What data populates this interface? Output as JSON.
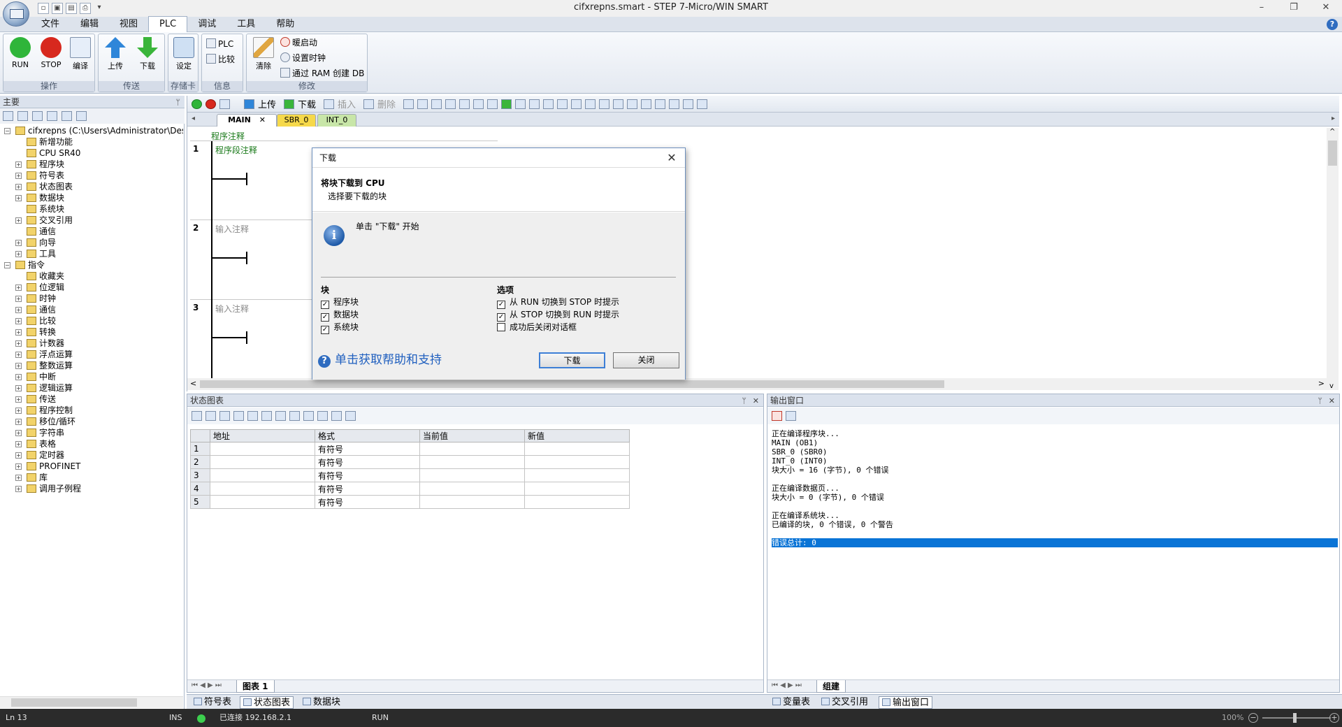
{
  "window": {
    "title": "cifxrepns.smart - STEP 7-Micro/WIN SMART",
    "quick_access": [
      "▫",
      "▣",
      "▤",
      "⎙",
      "▾"
    ],
    "controls": {
      "minimize": "–",
      "restore": "❐",
      "close": "✕"
    }
  },
  "menu": {
    "items": [
      "文件",
      "编辑",
      "视图",
      "PLC",
      "调试",
      "工具",
      "帮助"
    ],
    "active": "PLC",
    "help_icon": "?"
  },
  "ribbon": {
    "groups": [
      {
        "label": "操作",
        "buttons": [
          "RUN",
          "STOP",
          "编译"
        ]
      },
      {
        "label": "传送",
        "buttons": [
          "上传",
          "下载"
        ]
      },
      {
        "label": "存储卡",
        "buttons": [
          "设定"
        ]
      },
      {
        "label": "信息",
        "buttons": [
          "PLC",
          "比较"
        ]
      },
      {
        "label": "修改",
        "buttons": [
          "清除",
          "暖启动",
          "设置时钟",
          "通过 RAM 创建 DB"
        ]
      }
    ],
    "colors": {
      "run": "#2fb53a",
      "stop": "#d7281e",
      "upload": "#2f86d9",
      "download": "#3ab53a"
    }
  },
  "left_panel": {
    "title": "主要",
    "pin": "ᛘ",
    "tree": [
      {
        "label": "cifxrepns (C:\\Users\\Administrator\\Desktop\\hor",
        "level": 0,
        "exp": "−"
      },
      {
        "label": "新增功能",
        "level": 1,
        "exp": ""
      },
      {
        "label": "CPU SR40",
        "level": 1,
        "exp": ""
      },
      {
        "label": "程序块",
        "level": 1,
        "exp": "+"
      },
      {
        "label": "符号表",
        "level": 1,
        "exp": "+"
      },
      {
        "label": "状态图表",
        "level": 1,
        "exp": "+"
      },
      {
        "label": "数据块",
        "level": 1,
        "exp": "+"
      },
      {
        "label": "系统块",
        "level": 1,
        "exp": ""
      },
      {
        "label": "交叉引用",
        "level": 1,
        "exp": "+"
      },
      {
        "label": "通信",
        "level": 1,
        "exp": ""
      },
      {
        "label": "向导",
        "level": 1,
        "exp": "+"
      },
      {
        "label": "工具",
        "level": 1,
        "exp": "+"
      },
      {
        "label": "指令",
        "level": 0,
        "exp": "−"
      },
      {
        "label": "收藏夹",
        "level": 1,
        "exp": ""
      },
      {
        "label": "位逻辑",
        "level": 1,
        "exp": "+"
      },
      {
        "label": "时钟",
        "level": 1,
        "exp": "+"
      },
      {
        "label": "通信",
        "level": 1,
        "exp": "+"
      },
      {
        "label": "比较",
        "level": 1,
        "exp": "+"
      },
      {
        "label": "转换",
        "level": 1,
        "exp": "+"
      },
      {
        "label": "计数器",
        "level": 1,
        "exp": "+"
      },
      {
        "label": "浮点运算",
        "level": 1,
        "exp": "+"
      },
      {
        "label": "整数运算",
        "level": 1,
        "exp": "+"
      },
      {
        "label": "中断",
        "level": 1,
        "exp": "+"
      },
      {
        "label": "逻辑运算",
        "level": 1,
        "exp": "+"
      },
      {
        "label": "传送",
        "level": 1,
        "exp": "+"
      },
      {
        "label": "程序控制",
        "level": 1,
        "exp": "+"
      },
      {
        "label": "移位/循环",
        "level": 1,
        "exp": "+"
      },
      {
        "label": "字符串",
        "level": 1,
        "exp": "+"
      },
      {
        "label": "表格",
        "level": 1,
        "exp": "+"
      },
      {
        "label": "定时器",
        "level": 1,
        "exp": "+"
      },
      {
        "label": "PROFINET",
        "level": 1,
        "exp": "+"
      },
      {
        "label": "库",
        "level": 1,
        "exp": "+"
      },
      {
        "label": "调用子例程",
        "level": 1,
        "exp": "+"
      }
    ]
  },
  "editor": {
    "toolbar": {
      "upload": "上传",
      "download": "下载",
      "insert": "插入",
      "delete": "删除"
    },
    "tabs": [
      {
        "label": "MAIN",
        "close": "✕"
      },
      {
        "label": "SBR_0"
      },
      {
        "label": "INT_0"
      }
    ],
    "program_comment": "程序注释",
    "rungs": [
      {
        "num": "1",
        "comment": "程序段注释"
      },
      {
        "num": "2",
        "comment": "输入注释"
      },
      {
        "num": "3",
        "comment": "输入注释"
      }
    ],
    "scroll_arrows": {
      "left": "<",
      "right": ">",
      "up": "^",
      "down": "v",
      "tab_left": "◂",
      "tab_right": "▸"
    }
  },
  "dialog": {
    "title": "下载",
    "close": "✕",
    "heading": "将块下载到 CPU",
    "subheading": "选择要下载的块",
    "info_icon": "i",
    "message": "单击 \"下载\" 开始",
    "blocks_title": "块",
    "blocks": [
      {
        "label": "程序块",
        "checked": "✓"
      },
      {
        "label": "数据块",
        "checked": "✓"
      },
      {
        "label": "系统块",
        "checked": "✓"
      }
    ],
    "options_title": "选项",
    "options": [
      {
        "label": "从 RUN 切换到 STOP 时提示",
        "checked": "✓"
      },
      {
        "label": "从 STOP 切换到 RUN 时提示",
        "checked": "✓"
      },
      {
        "label": "成功后关闭对话框",
        "checked": ""
      }
    ],
    "help_icon": "?",
    "help_link": "单击获取帮助和支持",
    "download_button": "下载",
    "close_button": "关闭"
  },
  "status_chart": {
    "title": "状态图表",
    "pin": "ᛘ",
    "close": "✕",
    "columns": [
      "",
      "地址",
      "格式",
      "当前值",
      "新值"
    ],
    "rows": [
      {
        "idx": "1",
        "address": "",
        "format": "有符号",
        "current": "",
        "new": ""
      },
      {
        "idx": "2",
        "address": "",
        "format": "有符号",
        "current": "",
        "new": ""
      },
      {
        "idx": "3",
        "address": "",
        "format": "有符号",
        "current": "",
        "new": ""
      },
      {
        "idx": "4",
        "address": "",
        "format": "有符号",
        "current": "",
        "new": ""
      },
      {
        "idx": "5",
        "address": "",
        "format": "有符号",
        "current": "",
        "new": ""
      }
    ],
    "sheet_tab": "图表 1",
    "nav": "⏮ ◀ ▶ ⏭"
  },
  "output_window": {
    "title": "输出窗口",
    "pin": "ᛘ",
    "close": "✕",
    "lines": [
      "正在编译程序块...",
      "MAIN (OB1)",
      "SBR_0 (SBR0)",
      "INT_0 (INT0)",
      "块大小 = 16 (字节), 0 个错误",
      "",
      "正在编译数据页...",
      "块大小 = 0 (字节), 0 个错误",
      "",
      "正在编译系统块...",
      "已编译的块, 0 个错误, 0 个警告",
      "",
      "错误总计: 0"
    ],
    "highlight_index": 12,
    "sheet_tab": "组建",
    "nav": "⏮ ◀ ▶ ⏭"
  },
  "bottom_tabs": {
    "left": [
      "符号表",
      "状态图表",
      "数据块"
    ],
    "left_active": "状态图表",
    "right": [
      "变量表",
      "交叉引用",
      "输出窗口"
    ],
    "right_active": "输出窗口"
  },
  "statusbar": {
    "line": "Ln 13",
    "mode": "INS",
    "connection": "已连接 192.168.2.1",
    "plc_state": "RUN",
    "zoom": "100%",
    "connection_color": "#3ccf4e"
  }
}
